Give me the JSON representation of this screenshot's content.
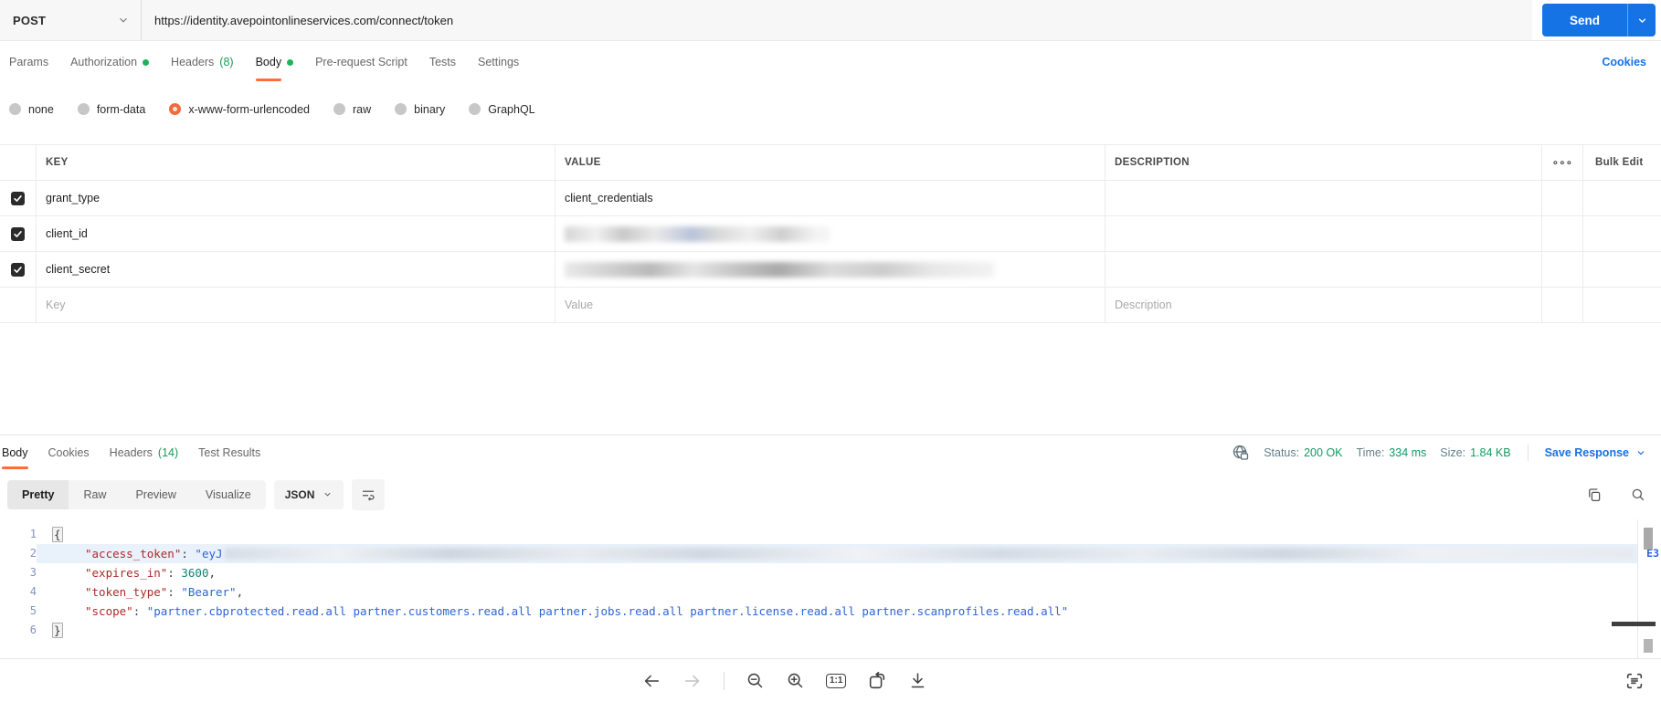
{
  "request": {
    "method": "POST",
    "url": "https://identity.avepointonlineservices.com/connect/token",
    "send_label": "Send",
    "cookies_link": "Cookies",
    "tabs": [
      {
        "label": "Params"
      },
      {
        "label": "Authorization",
        "dot": true
      },
      {
        "label": "Headers",
        "count": "(8)"
      },
      {
        "label": "Body",
        "dot": true,
        "active": true
      },
      {
        "label": "Pre-request Script"
      },
      {
        "label": "Tests"
      },
      {
        "label": "Settings"
      }
    ],
    "body_types": [
      "none",
      "form-data",
      "x-www-form-urlencoded",
      "raw",
      "binary",
      "GraphQL"
    ],
    "selected_body_type": "x-www-form-urlencoded",
    "table": {
      "headers": {
        "key": "KEY",
        "value": "VALUE",
        "description": "DESCRIPTION",
        "bulk_edit": "Bulk Edit"
      },
      "rows": [
        {
          "key": "grant_type",
          "value": "client_credentials",
          "checked": true,
          "value_blurred": false
        },
        {
          "key": "client_id",
          "value": "",
          "checked": true,
          "value_blurred": true
        },
        {
          "key": "client_secret",
          "value": "",
          "checked": true,
          "value_blurred": true
        }
      ],
      "placeholder_row": {
        "key": "Key",
        "value": "Value",
        "description": "Description"
      }
    }
  },
  "response": {
    "tabs": [
      {
        "label": "Body",
        "active": true
      },
      {
        "label": "Cookies"
      },
      {
        "label": "Headers",
        "count": "(14)"
      },
      {
        "label": "Test Results"
      }
    ],
    "meta": {
      "status_label": "Status:",
      "status_value": "200 OK",
      "time_label": "Time:",
      "time_value": "334 ms",
      "size_label": "Size:",
      "size_value": "1.84 KB",
      "save_label": "Save Response"
    },
    "view_tabs": [
      "Pretty",
      "Raw",
      "Preview",
      "Visualize"
    ],
    "active_view": "Pretty",
    "language": "JSON",
    "code_lines": [
      {
        "num": 1,
        "segments": [
          {
            "type": "bracket",
            "text": "{"
          }
        ]
      },
      {
        "num": 2,
        "indent": true,
        "highlighted": true,
        "tail": "E3",
        "segments": [
          {
            "type": "key",
            "text": "\"access_token\""
          },
          {
            "type": "punct",
            "text": ": "
          },
          {
            "type": "string",
            "text": "\"eyJ"
          },
          {
            "type": "blur"
          }
        ]
      },
      {
        "num": 3,
        "indent": true,
        "segments": [
          {
            "type": "key",
            "text": "\"expires_in\""
          },
          {
            "type": "punct",
            "text": ": "
          },
          {
            "type": "number",
            "text": "3600"
          },
          {
            "type": "punct",
            "text": ","
          }
        ]
      },
      {
        "num": 4,
        "indent": true,
        "segments": [
          {
            "type": "key",
            "text": "\"token_type\""
          },
          {
            "type": "punct",
            "text": ": "
          },
          {
            "type": "string",
            "text": "\"Bearer\""
          },
          {
            "type": "punct",
            "text": ","
          }
        ]
      },
      {
        "num": 5,
        "indent": true,
        "segments": [
          {
            "type": "key",
            "text": "\"scope\""
          },
          {
            "type": "punct",
            "text": ": "
          },
          {
            "type": "string",
            "text": "\"partner.cbprotected.read.all partner.customers.read.all partner.jobs.read.all partner.license.read.all partner.scanprofiles.read.all\""
          }
        ]
      },
      {
        "num": 6,
        "segments": [
          {
            "type": "bracket",
            "text": "}"
          }
        ]
      }
    ]
  },
  "footer": {
    "one_to_one_label": "1:1"
  },
  "icons": {
    "dots": "∘∘∘"
  },
  "colors": {
    "accent_orange": "#ff6c37",
    "primary_blue": "#1673e6",
    "count_green": "#169c54",
    "status_green": "#0f9d63",
    "json_key_red": "#ad2b2b",
    "json_string_blue": "#2f63d6",
    "json_number_teal": "#12846e"
  }
}
